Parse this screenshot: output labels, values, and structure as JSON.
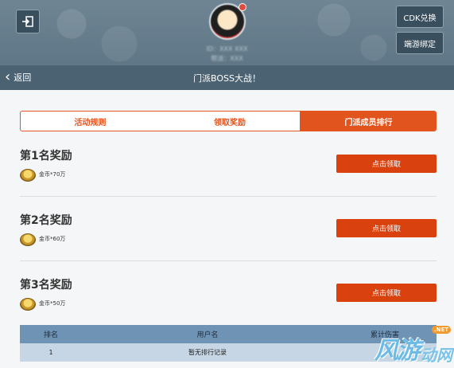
{
  "header": {
    "user_line1": "ID：XXX XXX",
    "user_line2": "帮派：XXX",
    "cdk_button": "CDK兑换",
    "bind_button": "端游绑定"
  },
  "nav": {
    "back_label": "返回",
    "title": "门派BOSS大战！"
  },
  "tabs": [
    {
      "label": "活动规则",
      "active": false
    },
    {
      "label": "领取奖励",
      "active": false
    },
    {
      "label": "门派成员排行",
      "active": true
    }
  ],
  "rewards": [
    {
      "title": "第1名奖励",
      "amount": "金币*70万",
      "button": "点击领取"
    },
    {
      "title": "第2名奖励",
      "amount": "金币*60万",
      "button": "点击领取"
    },
    {
      "title": "第3名奖励",
      "amount": "金币*50万",
      "button": "点击领取"
    }
  ],
  "ranking": {
    "headers": [
      "排名",
      "用户名",
      "累计伤害"
    ],
    "rows": [
      [
        "1",
        "暂无排行记录",
        ""
      ]
    ]
  },
  "watermark": {
    "big": "风游",
    "small": "动网",
    "net": ".NET"
  },
  "colors": {
    "accent": "#e2541e",
    "header_bg": "#5f7686",
    "subbar_bg": "#4b6272",
    "table_head": "#6f93b4",
    "table_row": "#c6d6e4"
  }
}
